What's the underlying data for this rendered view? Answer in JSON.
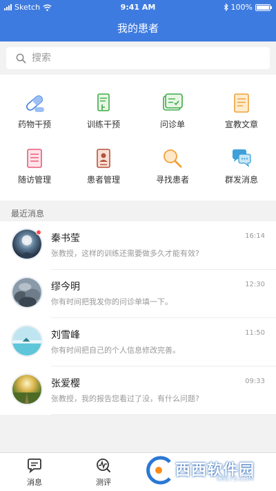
{
  "status_bar": {
    "carrier": "Sketch",
    "time": "9:41 AM",
    "battery": "100%"
  },
  "header": {
    "title": "我的患者"
  },
  "search": {
    "placeholder": "搜索"
  },
  "features": [
    {
      "label": "药物干预",
      "icon": "pill-icon"
    },
    {
      "label": "训练干预",
      "icon": "training-icon"
    },
    {
      "label": "问诊单",
      "icon": "inquiry-form-icon"
    },
    {
      "label": "宣教文章",
      "icon": "article-icon"
    },
    {
      "label": "随访管理",
      "icon": "followup-icon"
    },
    {
      "label": "患者管理",
      "icon": "patient-card-icon"
    },
    {
      "label": "寻找患者",
      "icon": "magnifier-icon"
    },
    {
      "label": "群发消息",
      "icon": "chat-bubbles-icon"
    }
  ],
  "recent": {
    "title": "最近消息",
    "items": [
      {
        "name": "秦书莹",
        "message": "张教授，这样的训练还需要做多久才能有效?",
        "time": "16:14",
        "unread": true
      },
      {
        "name": "缪今明",
        "message": "你有时间把我发你的问诊单填一下。",
        "time": "12:30",
        "unread": false
      },
      {
        "name": "刘雪峰",
        "message": "你有时间把自己的个人信息修改完善。",
        "time": "11:50",
        "unread": false
      },
      {
        "name": "张爱樱",
        "message": "张教授，我的报告您看过了没，有什么问题?",
        "time": "09:33",
        "unread": false
      }
    ]
  },
  "tabbar": [
    {
      "label": "消息",
      "icon": "message-icon"
    },
    {
      "label": "测评",
      "icon": "assessment-icon"
    }
  ],
  "watermark": {
    "text": "西西软件园",
    "url": "CR173.COM"
  },
  "colors": {
    "primary": "#3e7be0",
    "unread": "#ff4d4f"
  }
}
